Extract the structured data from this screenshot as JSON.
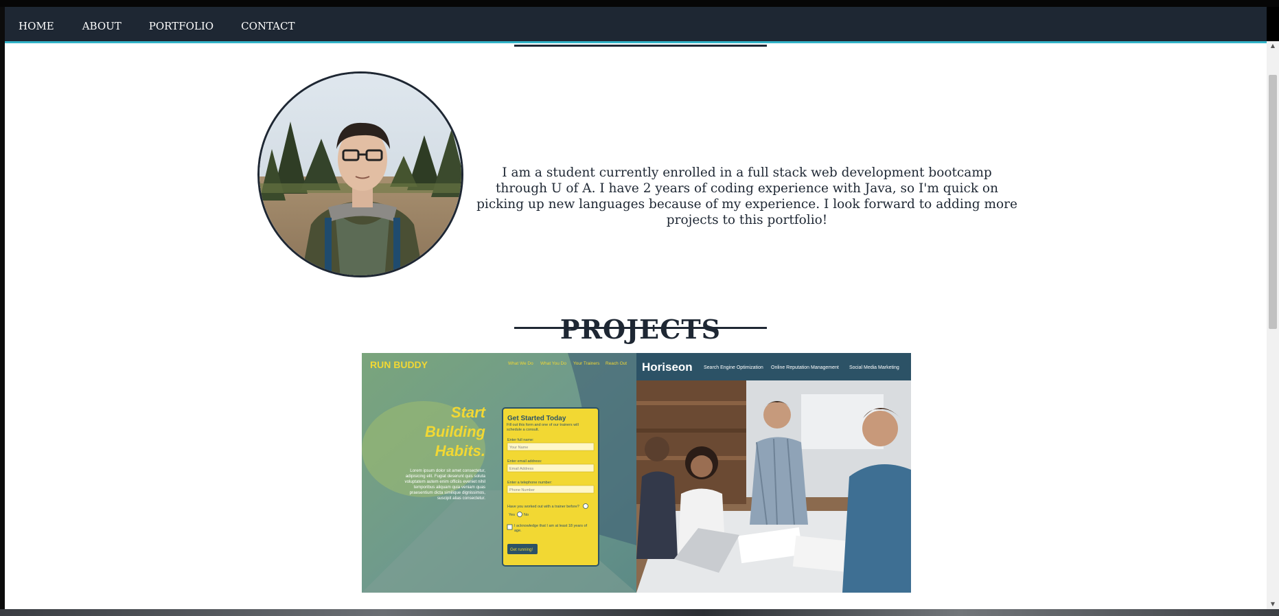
{
  "nav": {
    "items": [
      {
        "label": "HOME"
      },
      {
        "label": "ABOUT"
      },
      {
        "label": "PORTFOLIO"
      },
      {
        "label": "CONTACT"
      }
    ]
  },
  "about": {
    "text": "I am a student currently enrolled in a full stack web development bootcamp through U of A. I have 2 years of coding experience with Java, so I'm quick on picking up new languages because of my experience. I look forward to adding more projects to this portfolio!"
  },
  "projects": {
    "title": "PROJECTS",
    "items": [
      {
        "brand": "RUN BUDDY",
        "nav": [
          "What We Do",
          "What You Do",
          "Your Trainers",
          "Reach Out"
        ],
        "headline": [
          "Start",
          "Building",
          "Habits."
        ],
        "body": "Lorem ipsum dolor sit amet consectetur, adipisicing elit. Fugiat deserunt quis soluta voluptatem autem enim officiis eveniet nihil temporibus aliquam quia veniam quas praesentium dicta similique dignissimos, suscipit alias consectetur.",
        "form": {
          "title": "Get Started Today",
          "subtitle": "Fill out this form and one of our trainers will schedule a consult.",
          "name_label": "Enter full name:",
          "name_placeholder": "Your Name",
          "email_label": "Enter email address:",
          "email_placeholder": "Email Address",
          "phone_label": "Enter a telephone number:",
          "phone_placeholder": "Phone Number",
          "question": "Have you worked out with a trainer before?",
          "yes": "Yes",
          "no": "No",
          "ack": "I acknowledge that I am at least 18 years of age.",
          "button": "Get running!"
        }
      },
      {
        "brand": "Horiseon",
        "nav": [
          "Search Engine Optimization",
          "Online Reputation Management",
          "Social Media Marketing"
        ]
      }
    ]
  },
  "colors": {
    "nav_bg": "#1e2733",
    "nav_accent": "#32b3c8",
    "text": "#1e2733",
    "runbuddy_yellow": "#f2d833",
    "horiseon_header": "#2c5266"
  }
}
